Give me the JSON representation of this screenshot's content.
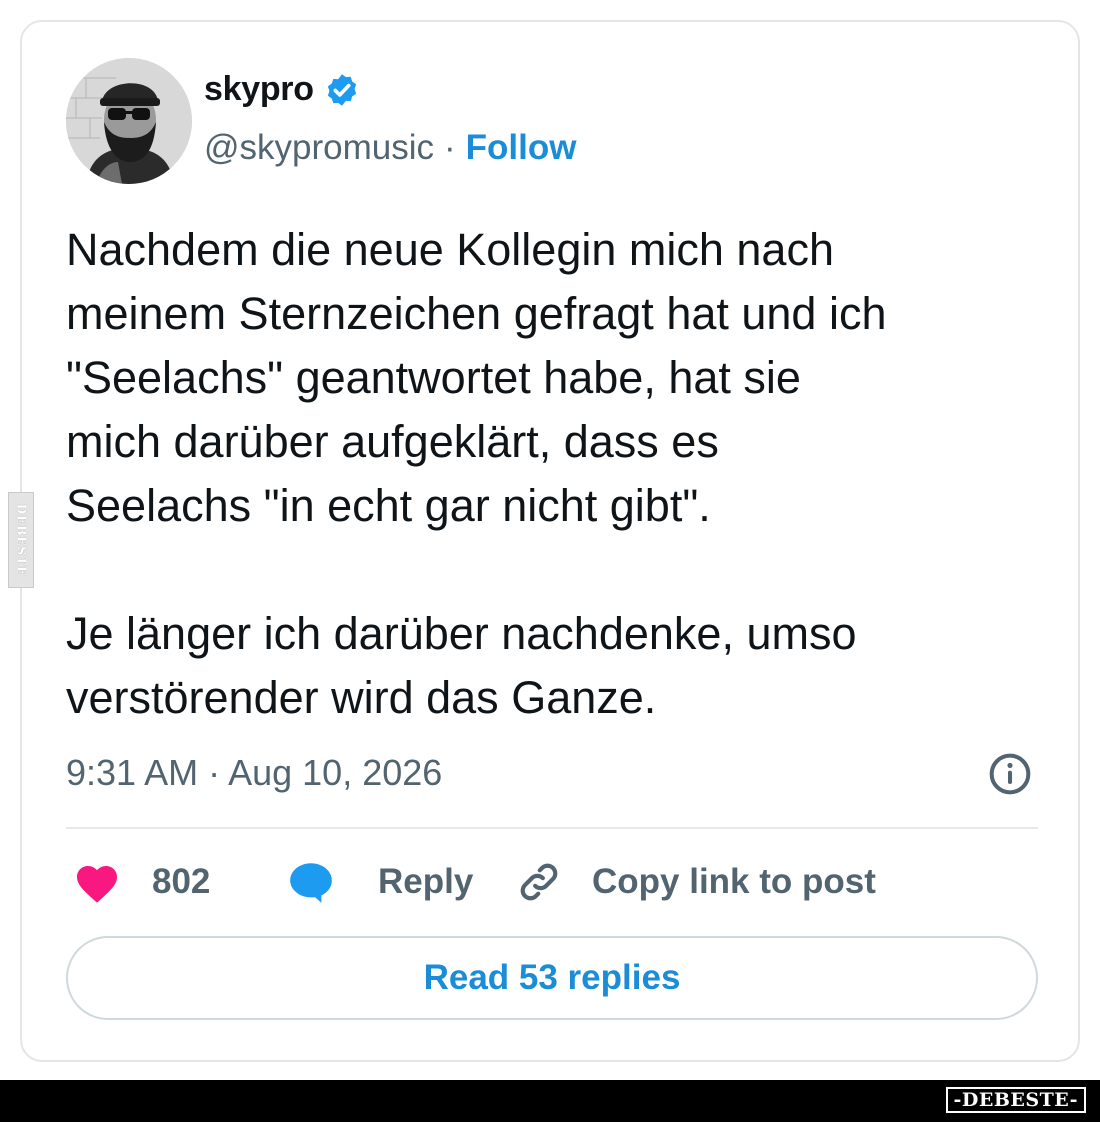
{
  "author": {
    "display_name": "skypro",
    "handle": "@skypromusic",
    "separator": "·",
    "follow_label": "Follow",
    "verified": true,
    "avatar_icon": "profile-photo-man-sunglasses-cap"
  },
  "tweet": {
    "text": "Nachdem die neue Kollegin mich nach\nmeinem Sternzeichen gefragt hat und ich\n\"Seelachs\" geantwortet habe, hat sie\nmich darüber aufgeklärt, dass es\nSeelachs \"in echt gar nicht gibt\".\n\nJe länger ich darüber nachdenke, umso\nverstörender wird das Ganze.",
    "timestamp": "9:31 AM · Aug 10, 2026"
  },
  "actions": {
    "like_count": "802",
    "reply_label": "Reply",
    "copy_link_label": "Copy link to post",
    "read_replies_label": "Read 53 replies"
  },
  "watermark": {
    "side_text": "DEBESTE",
    "footer_brand": "-DEBESTE-"
  },
  "colors": {
    "accent_blue": "#1a8cd8",
    "like_pink": "#f91880",
    "reply_blue": "#1d9bf0",
    "text_primary": "#0f1419",
    "text_secondary": "#536471"
  },
  "icons": [
    "verified-badge-icon",
    "info-icon",
    "heart-icon",
    "speech-bubble-icon",
    "link-icon"
  ]
}
